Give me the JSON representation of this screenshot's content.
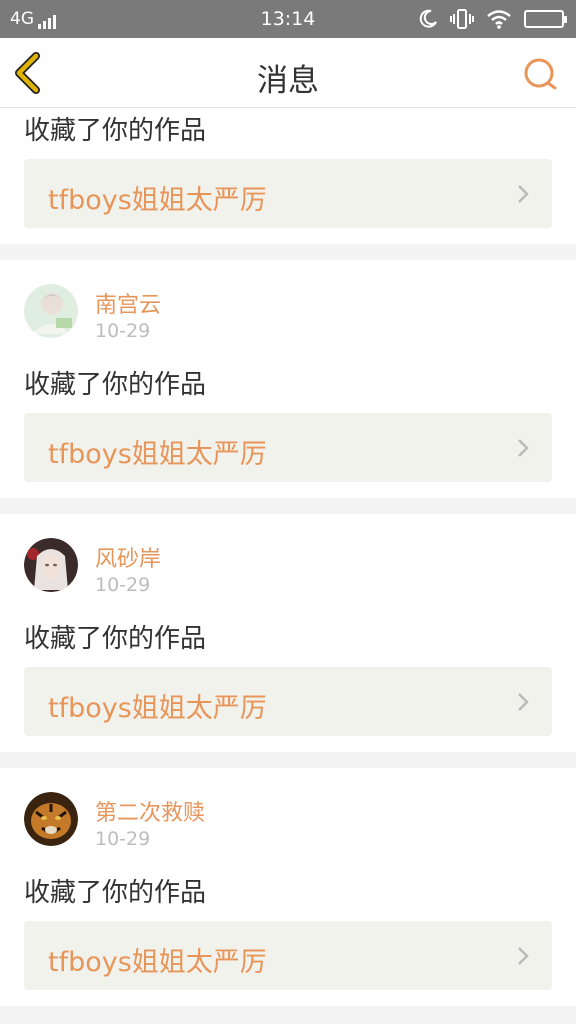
{
  "status_bar": {
    "network": "4G",
    "time": "13:14"
  },
  "header": {
    "title": "消息"
  },
  "notifications": [
    {
      "action": "收藏了你的作品",
      "work_title": "tfboys姐姐太严厉"
    },
    {
      "username": "南宫云",
      "time": "10-29",
      "action": "收藏了你的作品",
      "work_title": "tfboys姐姐太严厉"
    },
    {
      "username": "风砂岸",
      "time": "10-29",
      "action": "收藏了你的作品",
      "work_title": "tfboys姐姐太严厉"
    },
    {
      "username": "第二次救赎",
      "time": "10-29",
      "action": "收藏了你的作品",
      "work_title": "tfboys姐姐太严厉"
    }
  ],
  "colors": {
    "accent": "#e8955a",
    "back_arrow": "#e0b400",
    "status_bar_bg": "#7a7a7a"
  }
}
